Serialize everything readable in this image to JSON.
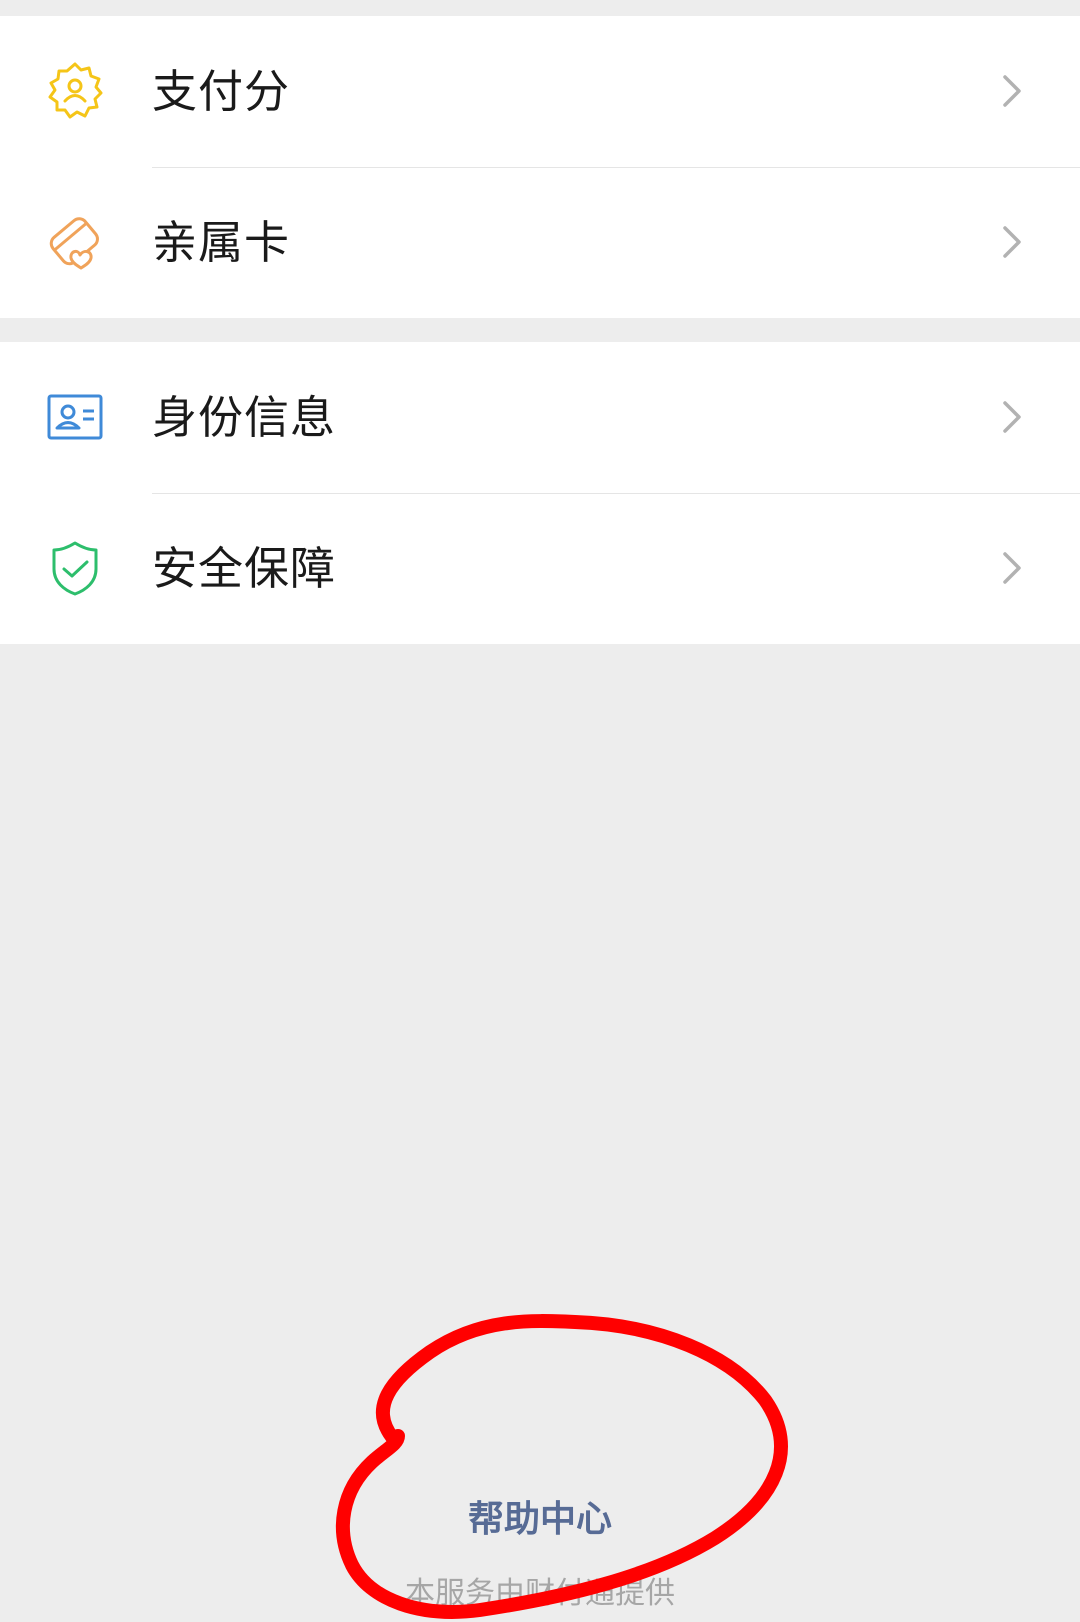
{
  "groups": [
    {
      "items": [
        {
          "label": "支付分",
          "icon": "payscore-badge-icon",
          "color": "#f5c518"
        },
        {
          "label": "亲属卡",
          "icon": "family-card-icon",
          "color": "#f0a35a"
        }
      ]
    },
    {
      "items": [
        {
          "label": "身份信息",
          "icon": "id-card-icon",
          "color": "#3f8ad8"
        },
        {
          "label": "安全保障",
          "icon": "shield-check-icon",
          "color": "#2dbe6c"
        }
      ]
    }
  ],
  "footer": {
    "help_label": "帮助中心",
    "provider_note": "本服务由财付通提供"
  },
  "colors": {
    "background": "#ededed",
    "link": "#576b95",
    "annotation": "#ff0000"
  }
}
